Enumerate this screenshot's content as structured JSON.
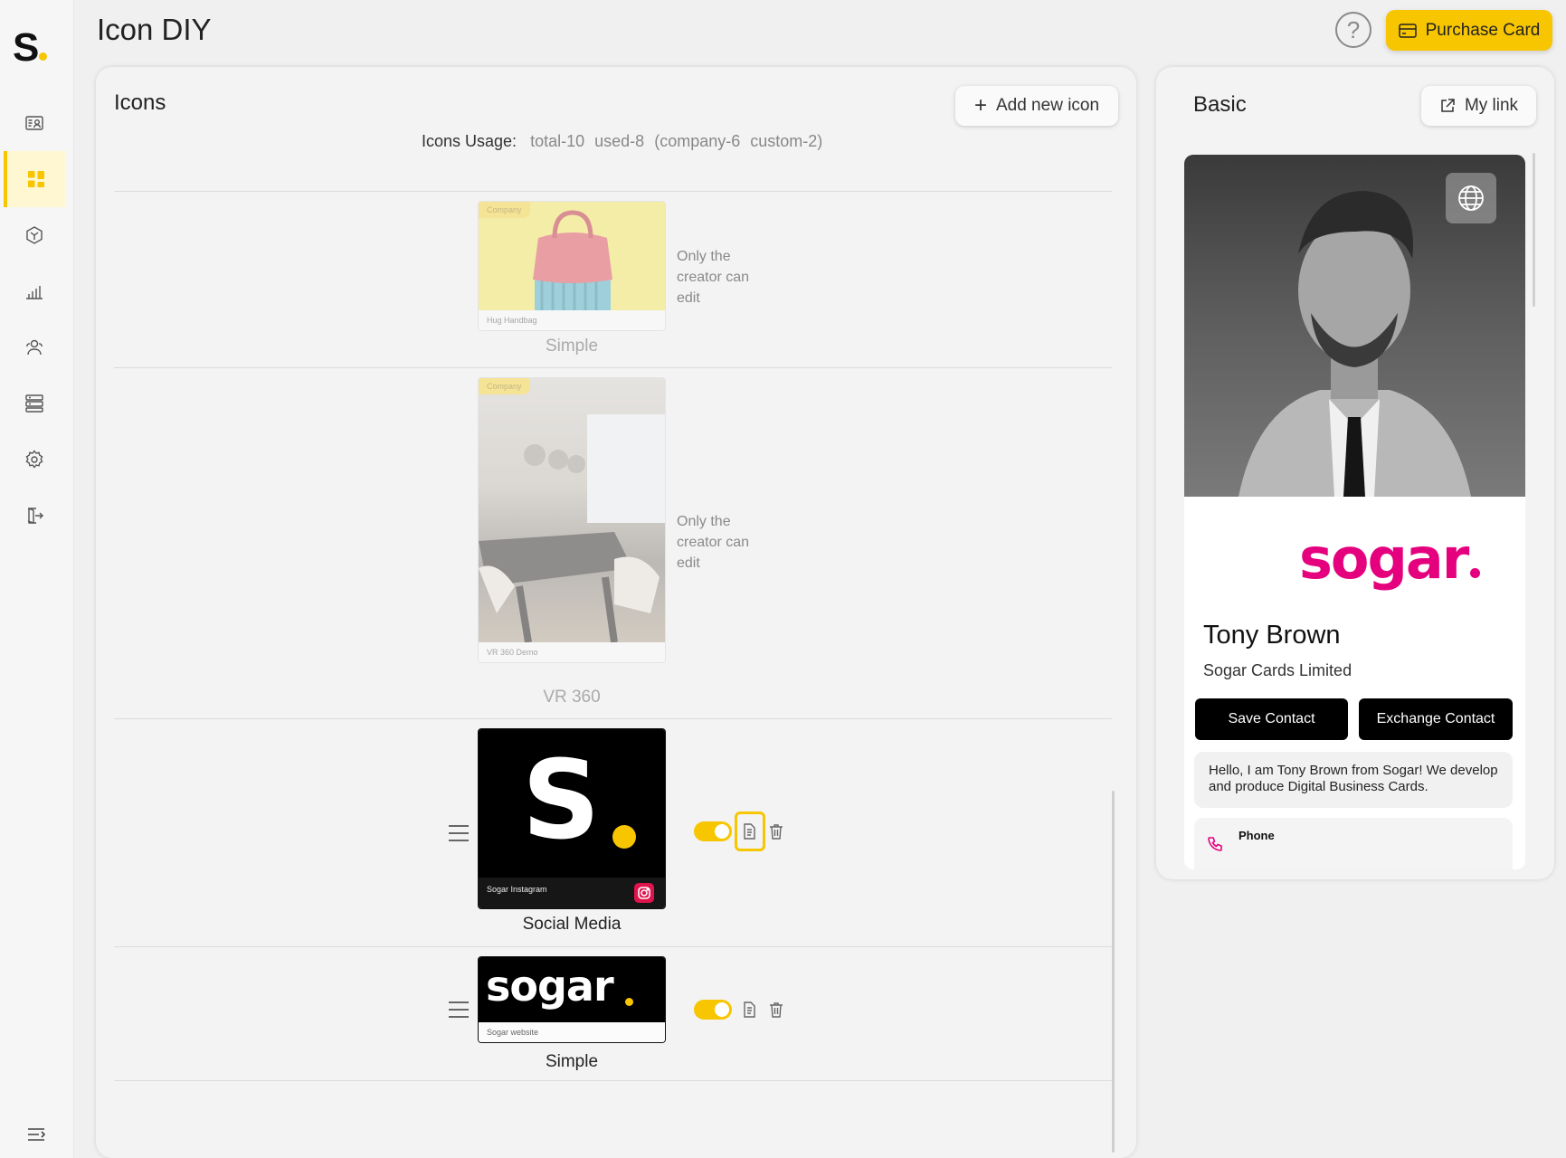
{
  "app": {
    "logo_text": "S",
    "page_title": "Icon DIY"
  },
  "sidebar": {
    "items": [
      {
        "name": "contact-card-icon",
        "active": false
      },
      {
        "name": "dashboard-grid-icon",
        "active": true
      },
      {
        "name": "cube-icon",
        "active": false
      },
      {
        "name": "bar-chart-icon",
        "active": false
      },
      {
        "name": "users-icon",
        "active": false
      },
      {
        "name": "server-icon",
        "active": false
      },
      {
        "name": "gear-icon",
        "active": false
      },
      {
        "name": "logout-icon",
        "active": false
      }
    ],
    "collapse_icon": "collapse-menu-icon"
  },
  "header": {
    "help_glyph": "?",
    "purchase_label": "Purchase Card"
  },
  "icons_panel": {
    "title": "Icons",
    "add_label": "Add new icon",
    "usage_label": "Icons Usage:",
    "usage_total": "total-10",
    "usage_used": "used-8",
    "usage_company": "(company-6",
    "usage_custom": "custom-2)",
    "rows": [
      {
        "tag": "Company",
        "caption": "Hug Handbag",
        "type": "Simple",
        "note": "Only the creator can edit"
      },
      {
        "tag": "Company",
        "caption": "VR 360 Demo",
        "type": "VR 360",
        "note": "Only the creator can edit"
      },
      {
        "caption": "Sogar Instagram",
        "type": "Social Media",
        "enabled": true
      },
      {
        "caption": "Sogar website",
        "type": "Simple",
        "enabled": true
      }
    ],
    "social_logo_text": "S",
    "website_logo_text": "sogar"
  },
  "preview": {
    "title": "Basic",
    "mylink_label": "My link",
    "brand": "sogar",
    "name": "Tony Brown",
    "company": "Sogar Cards Limited",
    "save_label": "Save Contact",
    "exchange_label": "Exchange Contact",
    "about": "Hello, I am Tony Brown from Sogar! We develop and produce Digital Business Cards.",
    "phone_label": "Phone"
  },
  "colors": {
    "accent": "#f7c600",
    "brand_pink": "#e5007e",
    "dark": "#000000"
  }
}
